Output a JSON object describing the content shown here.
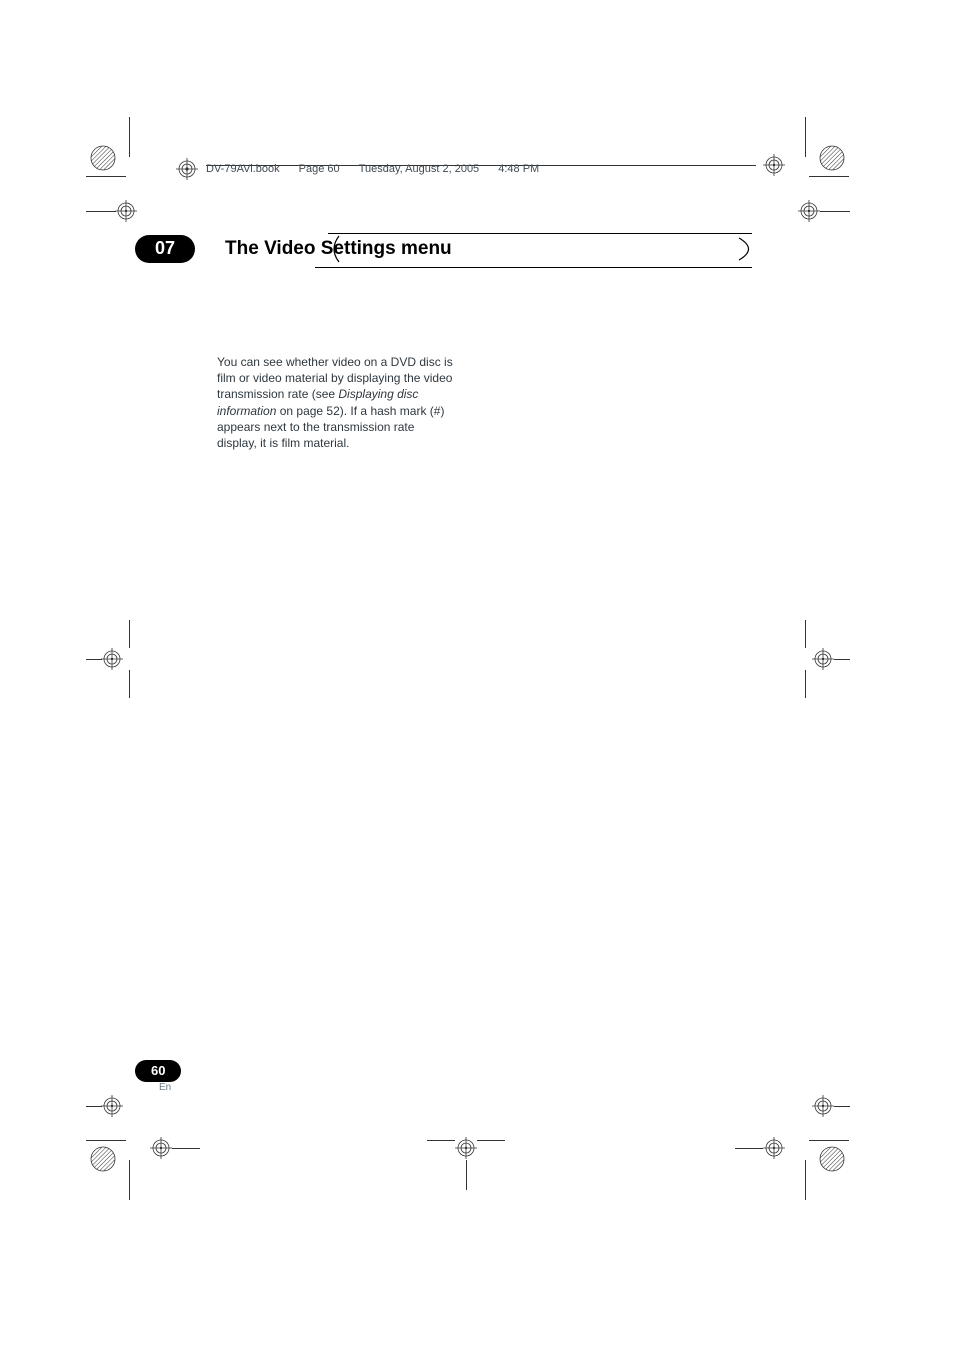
{
  "header": {
    "filename": "DV-79AVi.book",
    "page_info": "Page 60",
    "date": "Tuesday, August 2, 2005",
    "time": "4:48 PM"
  },
  "chapter": {
    "number": "07",
    "title": "The Video Settings menu"
  },
  "body": {
    "p1_a": "You can see whether video on a DVD disc is film or video material by displaying the video transmission rate (see ",
    "p1_em": "Displaying disc information",
    "p1_b": " on page 52). If a hash mark (#) appears next to the transmission rate display, it is film material."
  },
  "footer": {
    "page_number": "60",
    "language": "En"
  }
}
